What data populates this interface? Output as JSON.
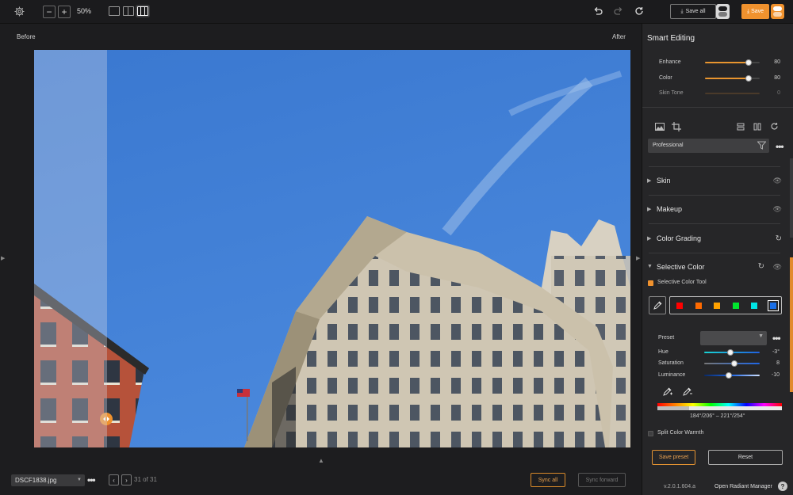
{
  "toolbar": {
    "zoom_out_label": "−",
    "zoom_in_label": "+",
    "zoom_level": "50%",
    "save_all_label": "Save all",
    "save_label": "Save"
  },
  "view": {
    "before_label": "Before",
    "after_label": "After"
  },
  "bottom": {
    "file_name": "DSCF1838.jpg",
    "counter": "31 of 31",
    "sync_all_label": "Sync all",
    "sync_forward_label": "Sync forward"
  },
  "panel": {
    "title": "Smart Editing",
    "sliders": [
      {
        "label": "Enhance",
        "value": "80",
        "fill": 0.8
      },
      {
        "label": "Color",
        "value": "80",
        "fill": 0.8
      },
      {
        "label": "Skin Tone",
        "value": "0",
        "fill": 0
      }
    ],
    "profile": "Professional",
    "sections": {
      "skin": "Skin",
      "makeup": "Makeup",
      "color_grading": "Color Grading",
      "selective_color": "Selective Color"
    },
    "selective": {
      "tool_label": "Selective Color Tool",
      "swatches": [
        "#ff0000",
        "#ff6a00",
        "#ffa200",
        "#00e62e",
        "#00e5e5",
        "#1a6fe8"
      ],
      "preset_label": "Preset",
      "hue_label": "Hue",
      "hue_value": "-3°",
      "saturation_label": "Saturation",
      "saturation_value": "8",
      "luminance_label": "Luminance",
      "luminance_value": "-10",
      "range_text": "184°/206° – 221°/254°",
      "split_warmth_label": "Split Color Warmth"
    },
    "save_preset_label": "Save preset",
    "reset_label": "Reset",
    "version": "v.2.0.1.604.a",
    "manager_label": "Open Radiant Manager",
    "help_label": "?"
  },
  "colors": {
    "accent": "#f0922e",
    "panel_bg": "#262628",
    "sky": "#3f7fd4"
  },
  "icons": [
    "gear-icon",
    "undo-icon",
    "redo-icon",
    "refresh-icon",
    "eye-icon",
    "filter-icon",
    "eyedropper-icon",
    "crop-icon",
    "image-icon"
  ]
}
